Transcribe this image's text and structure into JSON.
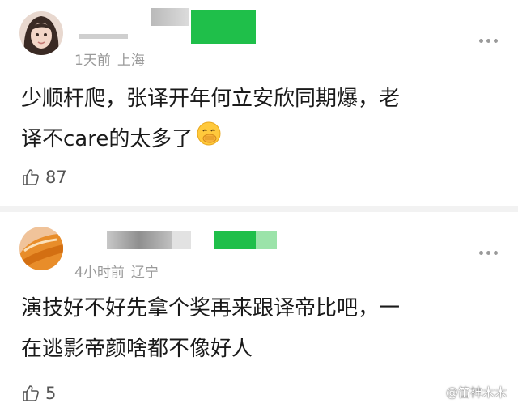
{
  "comments": [
    {
      "meta_time": "1天前",
      "meta_location": "上海",
      "text_line1": "少顺杆爬，张译开年何立安欣同期爆，老",
      "text_line2": "译不care的太多了",
      "emoji": "face-with-hand-over-mouth",
      "likes": "87"
    },
    {
      "meta_time": "4小时前",
      "meta_location": "辽宁",
      "text_line1": "演技好不好先拿个奖再来跟译帝比吧，一",
      "text_line2": "在逃影帝颜啥都不像好人",
      "likes": "5"
    }
  ],
  "watermark": "@笛神木木",
  "colors": {
    "meta": "#9a9a9a",
    "green_redaction": "#1fbf4a",
    "light_green_redaction": "#9be3a9",
    "divider": "#f2f2f2"
  }
}
